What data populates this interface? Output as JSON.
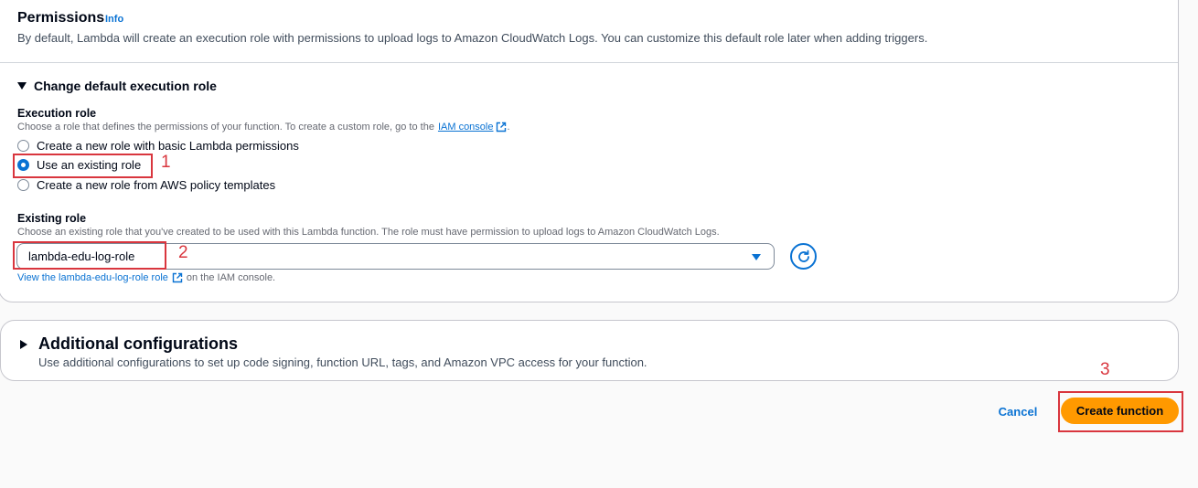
{
  "permissions": {
    "title": "Permissions",
    "info_label": "Info",
    "description": "By default, Lambda will create an execution role with permissions to upload logs to Amazon CloudWatch Logs. You can customize this default role later when adding triggers."
  },
  "execution_role_section": {
    "toggle_label": "Change default execution role",
    "expanded": true,
    "execution_role_label": "Execution role",
    "execution_role_help_prefix": "Choose a role that defines the permissions of your function. To create a custom role, go to the",
    "iam_console_link": "IAM console",
    "execution_role_help_suffix": ".",
    "options": [
      {
        "label": "Create a new role with basic Lambda permissions",
        "selected": false
      },
      {
        "label": "Use an existing role",
        "selected": true
      },
      {
        "label": "Create a new role from AWS policy templates",
        "selected": false
      }
    ],
    "existing_role_label": "Existing role",
    "existing_role_help": "Choose an existing role that you've created to be used with this Lambda function. The role must have permission to upload logs to Amazon CloudWatch Logs.",
    "existing_role_value": "lambda-edu-log-role",
    "view_role_link": "View the lambda-edu-log-role role",
    "view_role_suffix": "on the IAM console."
  },
  "additional_configurations": {
    "title": "Additional configurations",
    "description": "Use additional configurations to set up code signing, function URL, tags, and Amazon VPC access for your function.",
    "expanded": false
  },
  "footer": {
    "cancel_label": "Cancel",
    "create_label": "Create function"
  },
  "annotations": {
    "step1": "1",
    "step2": "2",
    "step3": "3"
  },
  "colors": {
    "accent": "#0972d3",
    "primary_button": "#ff9900",
    "annotation": "#d9363e"
  },
  "icons": {
    "external_link": "external-link-icon",
    "refresh": "refresh-icon",
    "caret": "caret-down-icon",
    "expand_open": "triangle-down-icon",
    "expand_closed": "triangle-right-icon"
  }
}
